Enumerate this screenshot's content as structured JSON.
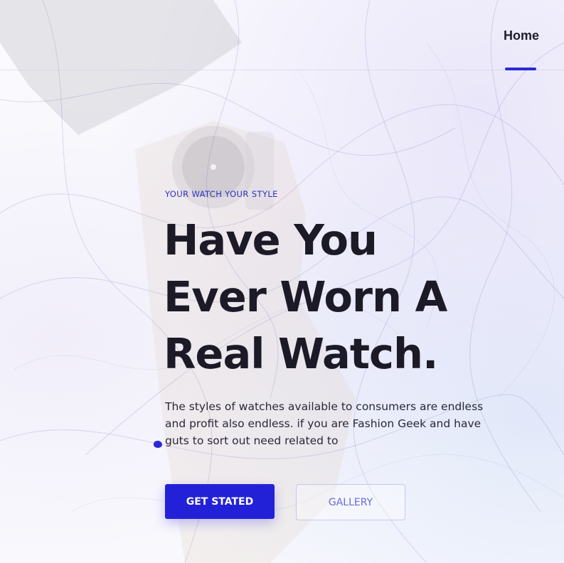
{
  "nav": {
    "home_label": "Home"
  },
  "hero": {
    "eyebrow": "YOUR WATCH YOUR STYLE",
    "headline_lines": [
      "Have You",
      "Ever Worn A",
      "Real Watch."
    ],
    "description": "The styles of watches available to consumers are endless and profit also endless. if you are Fashion Geek and have guts to sort out need related to",
    "primary_button": "GET STATED",
    "secondary_button": "GALLERY"
  },
  "colors": {
    "accent": "#2321d8",
    "heading": "#1c1a26",
    "secondary_button_text": "#6a6ad8"
  },
  "icons": {
    "cursor": "blob-cursor-icon"
  }
}
